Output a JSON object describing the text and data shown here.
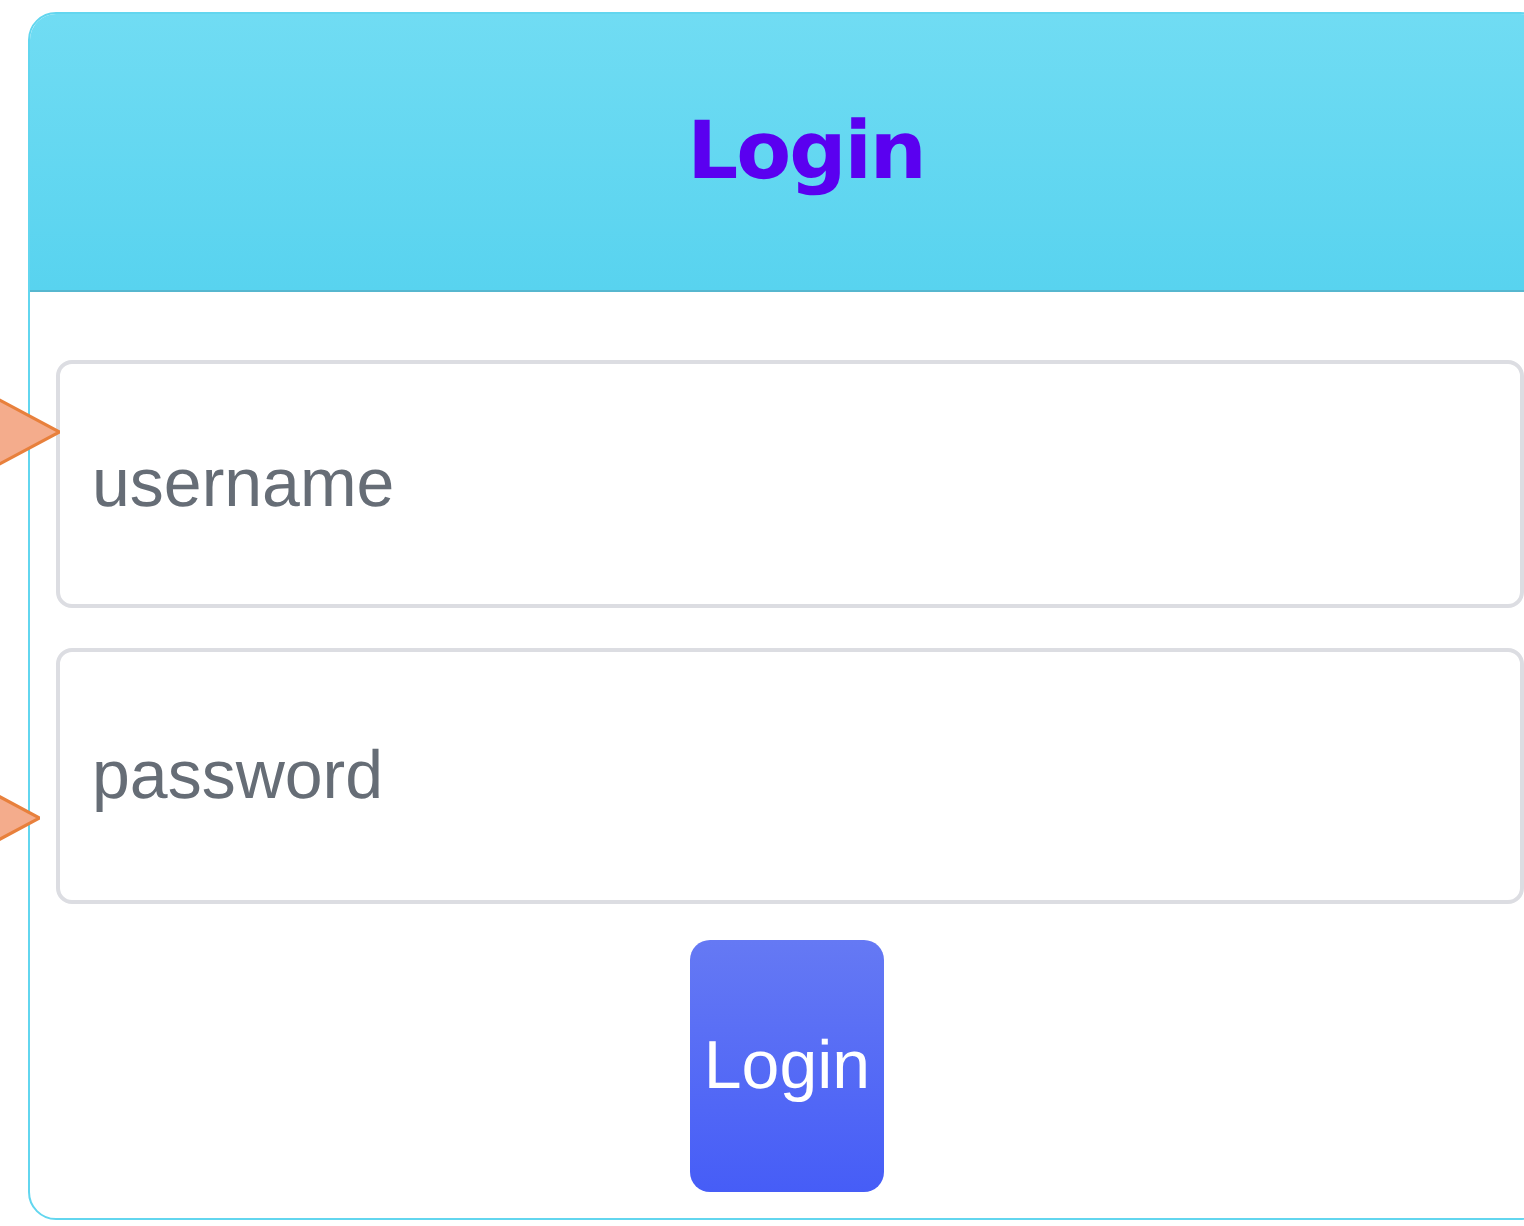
{
  "header": {
    "title": "Login"
  },
  "fields": [
    {
      "placeholder": "username"
    },
    {
      "placeholder": "password"
    }
  ],
  "button": {
    "label": "Login"
  }
}
